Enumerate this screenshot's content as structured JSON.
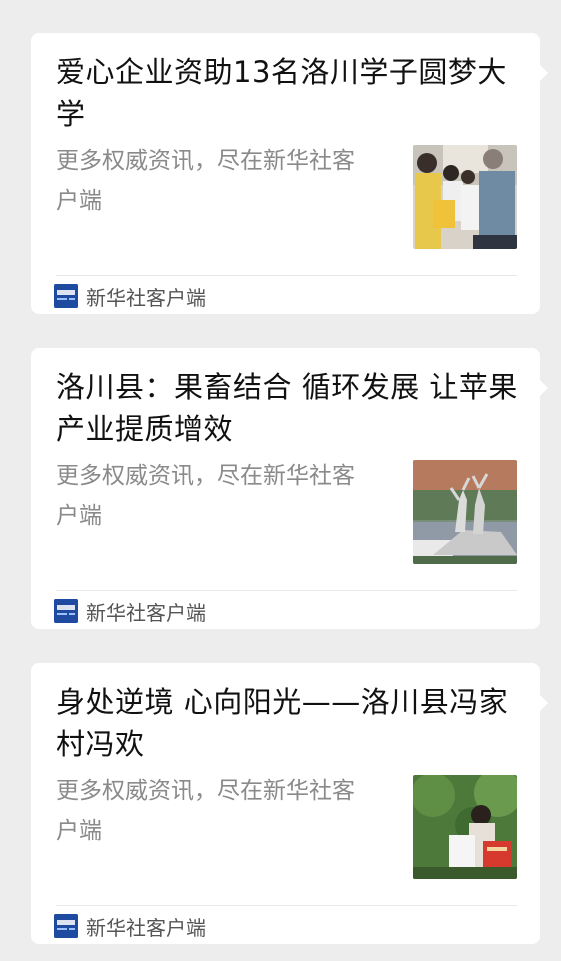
{
  "articles": [
    {
      "title": "爱心企业资助13名洛川学子圆梦大学",
      "description": "更多权威资讯，尽在新华社客户端",
      "thumbnail": "photo-students-receiving-aid",
      "source": "新华社客户端"
    },
    {
      "title": "洛川县：果畜结合 循环发展 让苹果产业提质增效",
      "description": "更多权威资讯，尽在新华社客户端",
      "thumbnail": "photo-deer-statue",
      "source": "新华社客户端"
    },
    {
      "title": "身处逆境 心向阳光——洛川县冯家村冯欢",
      "description": "更多权威资讯，尽在新华社客户端",
      "thumbnail": "photo-girl-holding-letter",
      "source": "新华社客户端"
    }
  ],
  "icons": {
    "source_logo": "xinhua-app-icon",
    "source_logo_color": "#1e4aa0"
  }
}
